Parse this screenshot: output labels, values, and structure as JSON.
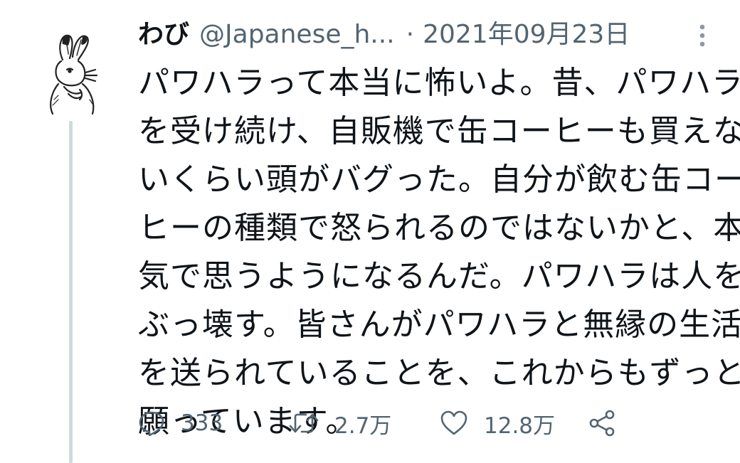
{
  "tweet": {
    "author": {
      "display_name": "わび",
      "handle": "@Japanese_h..."
    },
    "separator": "·",
    "date": "2021年09月23日",
    "body_lines": [
      "パワハラって本当に怖いよ。昔、パワハラ",
      "を受け続け、自販機で缶コーヒーも買えな",
      "いくらい頭がバグった。自分が飲む缶コー",
      "ヒーの種類で怒られるのではないかと、本",
      "気で思うようになるんだ。パワハラは人を",
      "ぶっ壊す。皆さんがパワハラと無縁の生活",
      "を送られていることを、これからもずっと",
      "願っています。"
    ],
    "actions": {
      "replies": "333",
      "retweets": "2.7万",
      "likes": "12.8万"
    }
  },
  "icons": {
    "avatar": "rabbit-sketch-avatar",
    "more": "more-vertical-icon",
    "reply": "reply-icon",
    "retweet": "retweet-icon",
    "like": "heart-icon",
    "share": "share-icon"
  },
  "colors": {
    "text_primary": "#0f1419",
    "text_secondary": "#536471",
    "thread_line": "#cfd9de",
    "background": "#ffffff"
  }
}
